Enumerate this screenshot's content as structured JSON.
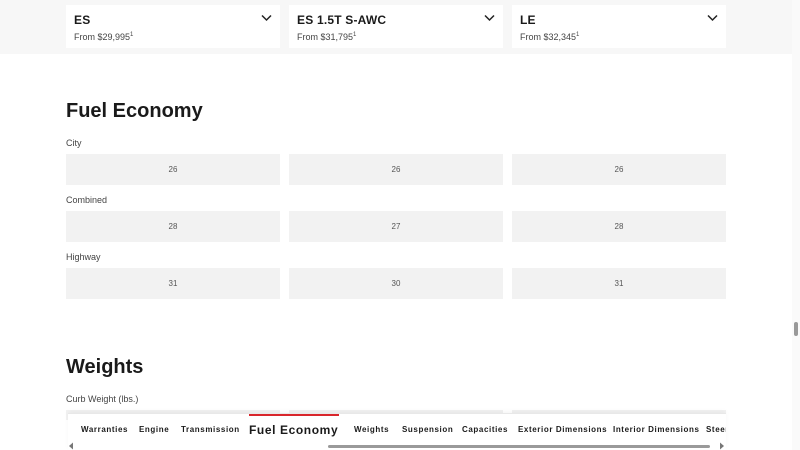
{
  "trims": [
    {
      "name": "ES",
      "price": "From $29,995",
      "sup": "1"
    },
    {
      "name": "ES 1.5T S-AWC",
      "price": "From $31,795",
      "sup": "1"
    },
    {
      "name": "LE",
      "price": "From $32,345",
      "sup": "1"
    }
  ],
  "fuel_economy": {
    "title": "Fuel Economy",
    "rows": [
      {
        "label": "City",
        "values": [
          "26",
          "26",
          "26"
        ]
      },
      {
        "label": "Combined",
        "values": [
          "28",
          "27",
          "28"
        ]
      },
      {
        "label": "Highway",
        "values": [
          "31",
          "30",
          "31"
        ]
      }
    ]
  },
  "weights": {
    "title": "Weights",
    "rows": [
      {
        "label": "Curb Weight (lbs.)"
      }
    ]
  },
  "tabs": [
    {
      "label": "Warranties",
      "active": false
    },
    {
      "label": "Engine",
      "active": false
    },
    {
      "label": "Transmission",
      "active": false
    },
    {
      "label": "Fuel Economy",
      "active": true
    },
    {
      "label": "Weights",
      "active": false
    },
    {
      "label": "Suspension",
      "active": false
    },
    {
      "label": "Capacities",
      "active": false
    },
    {
      "label": "Exterior Dimensions",
      "active": false
    },
    {
      "label": "Interior Dimensions",
      "active": false
    },
    {
      "label": "Steer",
      "active": false
    }
  ],
  "colors": {
    "accent": "#d9262c",
    "cell_bg": "#f2f2f2",
    "band_bg": "#f7f7f7"
  },
  "icons": {
    "trim_toggle": "chevron-down-icon",
    "tab_prev": "chevron-left-icon",
    "tab_next": "chevron-right-icon"
  }
}
